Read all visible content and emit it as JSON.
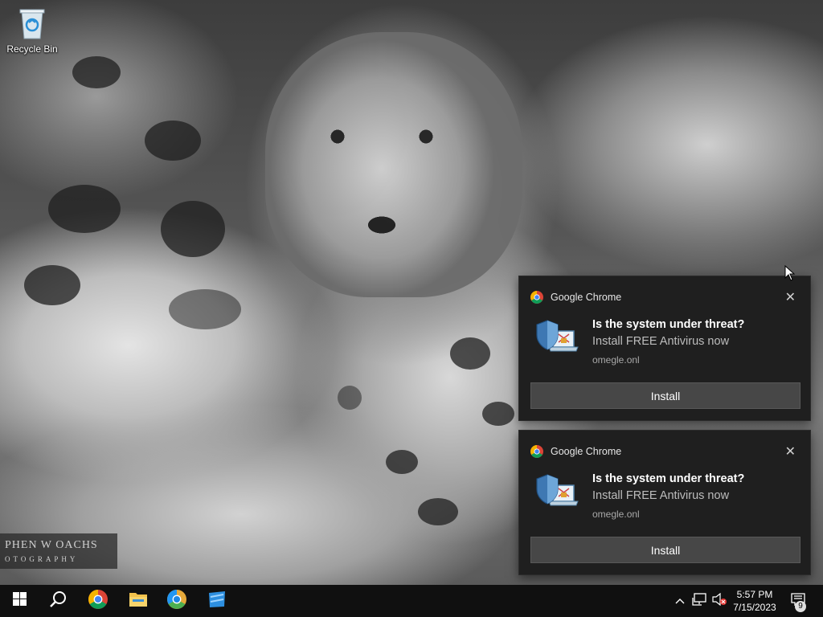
{
  "desktop": {
    "icons": [
      {
        "label": "Recycle Bin",
        "icon": "recycle-bin-icon"
      }
    ],
    "watermark": {
      "line1": "PHEN W OACHS",
      "line2": "OTOGRAPHY"
    }
  },
  "notifications": [
    {
      "app_name": "Google Chrome",
      "title": "Is the system under threat?",
      "message": "Install FREE Antivirus now",
      "source": "omegle.onl",
      "button_label": "Install",
      "close_label": "✕"
    },
    {
      "app_name": "Google Chrome",
      "title": "Is the system under threat?",
      "message": "Install FREE Antivirus now",
      "source": "omegle.onl",
      "button_label": "Install",
      "close_label": "✕"
    }
  ],
  "taskbar": {
    "pinned": [
      "windows-start-icon",
      "search-icon",
      "chrome-icon",
      "file-explorer-icon",
      "chrome-canary-icon",
      "store-app-icon"
    ],
    "tray": {
      "time": "5:57 PM",
      "date": "7/15/2023",
      "notification_count": "9"
    }
  },
  "colors": {
    "toast_bg": "#1f1f1f",
    "button_bg": "#474747",
    "taskbar_bg": "#101010"
  }
}
